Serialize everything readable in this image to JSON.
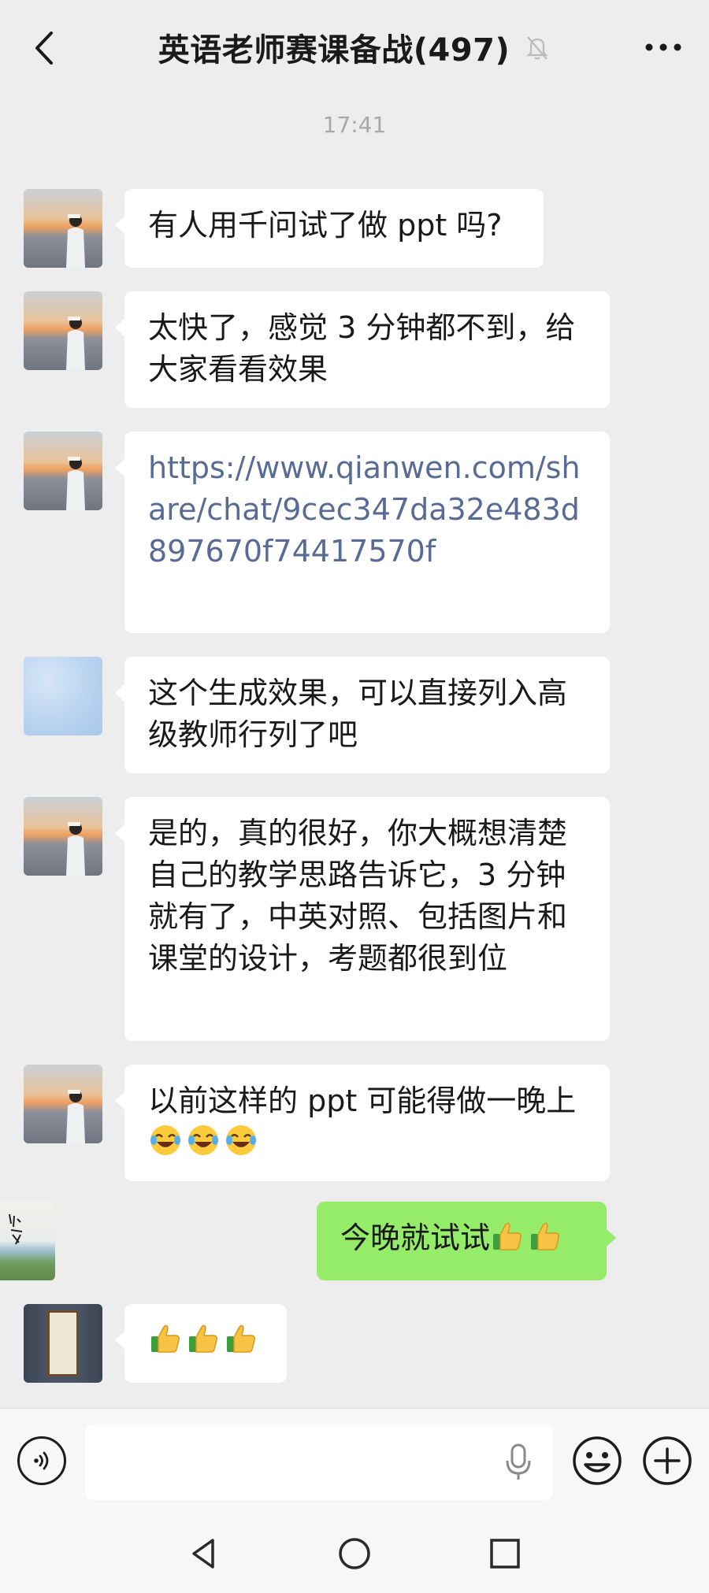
{
  "header": {
    "title": "英语老师赛课备战(497)",
    "icons": [
      "chevron-left-icon",
      "bell-muted-icon",
      "more-icon"
    ]
  },
  "timestamp": "17:41",
  "messages": [
    {
      "side": "left",
      "avatar": "sunset-girl",
      "text": "有人用千问试了做 ppt 吗?"
    },
    {
      "side": "left",
      "avatar": "sunset-girl",
      "text": "太快了，感觉 3 分钟都不到，给大家看看效果"
    },
    {
      "side": "left",
      "avatar": "sunset-girl",
      "type": "link",
      "text": "https://www.qianwen.com/share/chat/9cec347da32e483d897670f74417570f"
    },
    {
      "side": "left",
      "avatar": "blue-pattern",
      "text": "这个生成效果，可以直接列入高级教师行列了吧"
    },
    {
      "side": "left",
      "avatar": "sunset-girl",
      "text": "是的，真的很好，你大概想清楚自己的教学思路告诉它，3 分钟就有了，中英对照、包括图片和课堂的设计，考题都很到位"
    },
    {
      "side": "left",
      "avatar": "sunset-girl",
      "text": "以前这样的 ppt 可能得做一晚上",
      "emojis": [
        "rolling-laughing",
        "rolling-laughing",
        "rolling-laughing"
      ]
    },
    {
      "side": "right",
      "avatar": "landscape",
      "text": "今晚就试试",
      "emojis": [
        "thumbs-up",
        "thumbs-up"
      ]
    },
    {
      "side": "left",
      "avatar": "scroll-art",
      "text": "",
      "emojis": [
        "thumbs-up",
        "thumbs-up",
        "thumbs-up"
      ]
    }
  ],
  "input": {
    "placeholder": "",
    "icons": [
      "voice-icon",
      "microphone-icon",
      "emoji-icon",
      "plus-icon"
    ]
  },
  "navbar": {
    "icons": [
      "nav-back-icon",
      "nav-home-icon",
      "nav-recent-icon"
    ]
  },
  "colors": {
    "background": "#ededed",
    "bubble_left": "#ffffff",
    "bubble_right": "#95ec69",
    "link": "#576b95",
    "timestamp": "#a8a8a8"
  }
}
